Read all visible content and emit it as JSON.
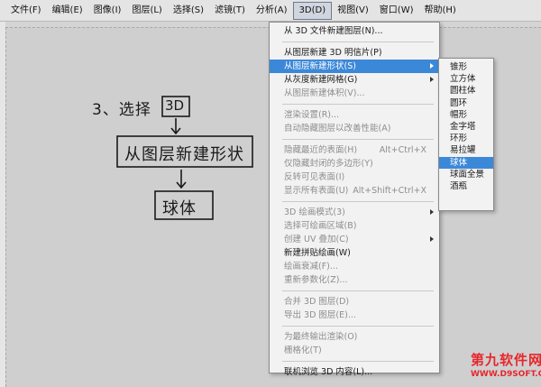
{
  "menubar": {
    "items": [
      {
        "label": "文件(F)"
      },
      {
        "label": "编辑(E)"
      },
      {
        "label": "图像(I)"
      },
      {
        "label": "图层(L)"
      },
      {
        "label": "选择(S)"
      },
      {
        "label": "滤镜(T)"
      },
      {
        "label": "分析(A)"
      },
      {
        "label": "3D(D)"
      },
      {
        "label": "视图(V)"
      },
      {
        "label": "窗口(W)"
      },
      {
        "label": "帮助(H)"
      }
    ],
    "active": "3D(D)"
  },
  "menu_3d": {
    "items": [
      {
        "label": "从 3D 文件新建图层(N)...",
        "enabled": true
      },
      {
        "label": "从图层新建 3D 明信片(P)",
        "enabled": true
      },
      {
        "label": "从图层新建形状(S)",
        "enabled": true,
        "submenu": true,
        "highlighted": true
      },
      {
        "label": "从灰度新建网格(G)",
        "enabled": true,
        "submenu": true
      },
      {
        "label": "从图层新建体积(V)...",
        "enabled": false
      },
      {
        "label": "渲染设置(R)...",
        "enabled": false
      },
      {
        "label": "自动隐藏图层以改善性能(A)",
        "enabled": false
      },
      {
        "label": "隐藏最近的表面(H)",
        "shortcut": "Alt+Ctrl+X",
        "enabled": false
      },
      {
        "label": "仅隐藏封闭的多边形(Y)",
        "enabled": false
      },
      {
        "label": "反转可见表面(I)",
        "enabled": false
      },
      {
        "label": "显示所有表面(U)",
        "shortcut": "Alt+Shift+Ctrl+X",
        "enabled": false
      },
      {
        "label": "3D 绘画模式(3)",
        "enabled": false,
        "submenu": true
      },
      {
        "label": "选择可绘画区域(B)",
        "enabled": false
      },
      {
        "label": "创建 UV 叠加(C)",
        "enabled": false,
        "submenu": true
      },
      {
        "label": "新建拼贴绘画(W)",
        "enabled": true
      },
      {
        "label": "绘画衰减(F)...",
        "enabled": false
      },
      {
        "label": "重新参数化(Z)...",
        "enabled": false
      },
      {
        "label": "合并 3D 图层(D)",
        "enabled": false
      },
      {
        "label": "导出 3D 图层(E)...",
        "enabled": false
      },
      {
        "label": "为最终输出渲染(O)",
        "enabled": false
      },
      {
        "label": "栅格化(T)",
        "enabled": false
      },
      {
        "label": "联机浏览 3D 内容(L)...",
        "enabled": true
      }
    ]
  },
  "submenu_shapes": {
    "items": [
      {
        "label": "锥形"
      },
      {
        "label": "立方体"
      },
      {
        "label": "圆柱体"
      },
      {
        "label": "圆环"
      },
      {
        "label": "帽形"
      },
      {
        "label": "金字塔"
      },
      {
        "label": "环形"
      },
      {
        "label": "易拉罐"
      },
      {
        "label": "球体",
        "highlighted": true
      },
      {
        "label": "球面全景"
      },
      {
        "label": "酒瓶"
      }
    ]
  },
  "drawing": {
    "step_label": "3、选择",
    "step_box": "3D",
    "middle_box": "从图层新建形状",
    "bottom_box": "球体"
  },
  "watermark": {
    "line1": "第九软件网",
    "line2": "WWW.D9SOFT.COM"
  },
  "colors": {
    "highlight": "#3c88d8",
    "menu_bg": "#f2f2f2",
    "canvas_bg": "#cfcfcf",
    "watermark": "#e8262b"
  }
}
